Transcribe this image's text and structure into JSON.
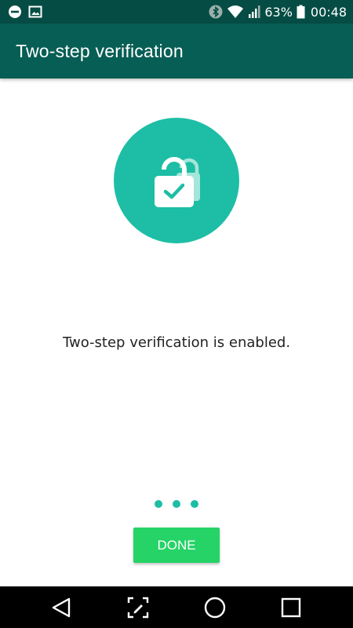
{
  "status_bar": {
    "left_icons": [
      "do-not-disturb-icon",
      "image-notification-icon"
    ],
    "right_icons": [
      "bluetooth-icon",
      "wifi-icon",
      "signal-icon",
      "battery-icon"
    ],
    "battery": "63%",
    "time": "00:48"
  },
  "app_bar": {
    "title": "Two-step verification"
  },
  "main": {
    "hero_icon": "lock-check-icon",
    "message": "Two-step verification is enabled.",
    "dots_count": 3,
    "done_label": "DONE"
  },
  "nav_bar": {
    "buttons": [
      "back-icon",
      "screenshot-edit-icon",
      "home-icon",
      "recents-icon"
    ]
  },
  "colors": {
    "status_bar": "#054d44",
    "app_bar": "#075e54",
    "accent": "#1dbea5",
    "button": "#25d366"
  }
}
